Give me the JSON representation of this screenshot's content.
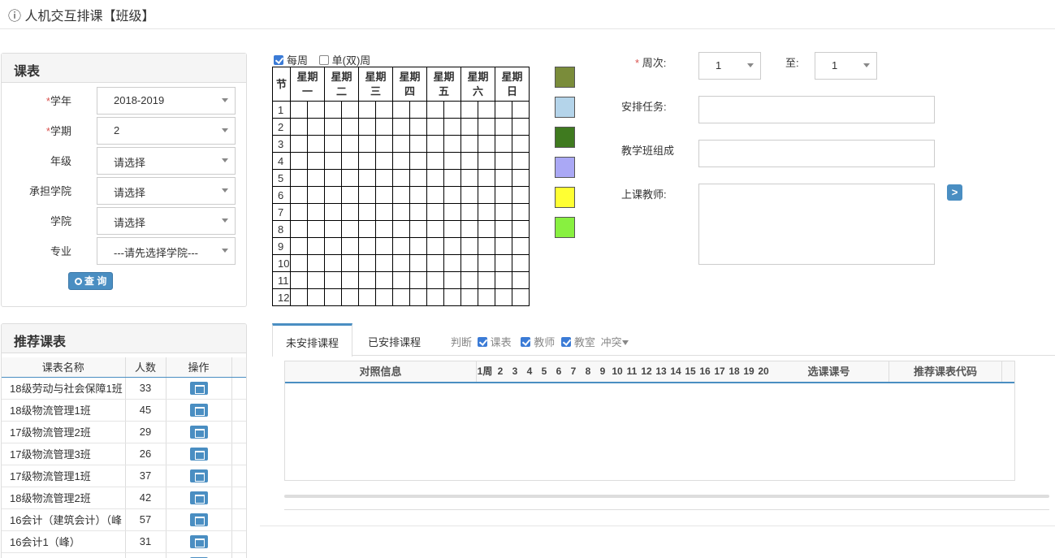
{
  "header": {
    "title": "ⓘ 人机交互排课【班级】"
  },
  "query_panel": {
    "title": "课表",
    "fields": [
      {
        "label": "学年",
        "required": "*",
        "value": "2018-2019"
      },
      {
        "label": "学期",
        "required": "*",
        "value": "2"
      },
      {
        "label": "年级",
        "required": "",
        "value": "请选择"
      },
      {
        "label": "承担学院",
        "required": "",
        "value": "请选择"
      },
      {
        "label": "学院",
        "required": "",
        "value": "请选择"
      },
      {
        "label": "专业",
        "required": "",
        "value": "---请先选择学院---"
      }
    ],
    "query_button": "查 询"
  },
  "recommend_panel": {
    "title": "推荐课表",
    "columns": [
      "课表名称",
      "人数",
      "操作"
    ],
    "rows": [
      {
        "name": "18级劳动与社会保障1班",
        "count": "33"
      },
      {
        "name": "18级物流管理1班",
        "count": "45"
      },
      {
        "name": "17级物流管理2班",
        "count": "29"
      },
      {
        "name": "17级物流管理3班",
        "count": "26"
      },
      {
        "name": "17级物流管理1班",
        "count": "37"
      },
      {
        "name": "18级物流管理2班",
        "count": "42"
      },
      {
        "name": "16会计（建筑会计）（峰",
        "count": "57"
      },
      {
        "name": "16会计1（峰）",
        "count": "31"
      }
    ]
  },
  "week_options": {
    "every_week": "每周",
    "odd_even": "单(双)周"
  },
  "grid": {
    "corner": "节",
    "days": [
      [
        "星期",
        "一"
      ],
      [
        "星期",
        "二"
      ],
      [
        "星期",
        "三"
      ],
      [
        "星期",
        "四"
      ],
      [
        "星期",
        "五"
      ],
      [
        "星期",
        "六"
      ],
      [
        "星期",
        "日"
      ]
    ],
    "periods": [
      "1",
      "2",
      "3",
      "4",
      "5",
      "6",
      "7",
      "8",
      "9",
      "10",
      "11",
      "12"
    ]
  },
  "swatches": [
    "#7a8c3a",
    "#b4d4ea",
    "#3f7a1f",
    "#aaa8f5",
    "#ffff33",
    "#88f040"
  ],
  "right_form": {
    "week_label": "周次:",
    "week_required": "*",
    "week_from": "1",
    "to_label": "至:",
    "week_to": "1",
    "task_label": "安排任务:",
    "class_label": "教学班组成",
    "teacher_label": "上课教师:",
    "go_button": ">"
  },
  "tabs": {
    "unscheduled": "未安排课程",
    "scheduled": "已安排课程",
    "judge_label": "判断",
    "judge_items": [
      "课表",
      "教师",
      "教室"
    ],
    "conflict": "冲突"
  },
  "sub_table": {
    "col_info": "对照信息",
    "weeks": [
      "1周",
      "2",
      "3",
      "4",
      "5",
      "6",
      "7",
      "8",
      "9",
      "10",
      "11",
      "12",
      "13",
      "14",
      "15",
      "16",
      "17",
      "18",
      "19",
      "20"
    ],
    "col_course_no": "选课课号",
    "col_recommend_code": "推荐课表代码"
  }
}
